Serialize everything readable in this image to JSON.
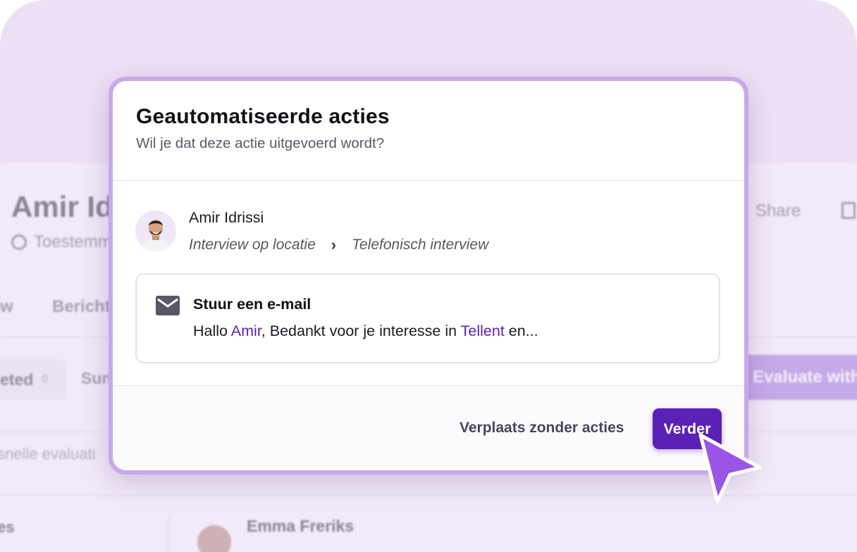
{
  "background_app": {
    "candidate_name_partial": "Amir Id",
    "consent_partial": "Toestemm",
    "share_label": "Share",
    "tab_partial_1": "w",
    "tab_partial_2": "Bericht",
    "pill_completed_partial": "eted",
    "pill_completed_count": "0",
    "pill_summary_partial": "Sun",
    "evaluate_button_partial": "Evaluate with",
    "quick_eval_partial": "snelle evaluati",
    "section_partial": "es",
    "list_person_name": "Emma Freriks"
  },
  "modal": {
    "title": "Geautomatiseerde acties",
    "subtitle": "Wil je dat deze actie uitgevoerd wordt?",
    "candidate": {
      "name": "Amir Idrissi",
      "from_stage": "Interview op locatie",
      "separator": "›",
      "to_stage": "Telefonisch interview"
    },
    "action": {
      "icon": "mail-icon",
      "title": "Stuur een e-mail",
      "body_prefix": "Hallo ",
      "body_name": "Amir",
      "body_middle": ", Bedankt voor je interesse in ",
      "body_company": "Tellent",
      "body_suffix": " en..."
    },
    "footer": {
      "skip_label": "Verplaats zonder acties",
      "next_label": "Verder"
    }
  },
  "colors": {
    "accent": "#5b21b6",
    "frame": "#c8a8ea",
    "canvas": "#ede2f5",
    "cursor": "#9b55e6"
  }
}
